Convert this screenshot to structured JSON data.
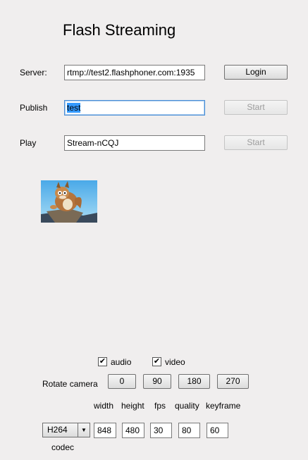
{
  "title": "Flash Streaming",
  "server": {
    "label": "Server:",
    "value": "rtmp://test2.flashphoner.com:1935",
    "button": "Login"
  },
  "publish": {
    "label": "Publish",
    "value": "test",
    "button": "Start"
  },
  "play": {
    "label": "Play",
    "value": "Stream-nCQJ",
    "button": "Start"
  },
  "media": {
    "audio_label": "audio",
    "video_label": "video",
    "audio_checked": true,
    "video_checked": true
  },
  "rotate": {
    "label": "Rotate camera",
    "options": [
      "0",
      "90",
      "180",
      "270"
    ]
  },
  "params": {
    "headers": [
      "width",
      "height",
      "fps",
      "quality",
      "keyframe"
    ],
    "values": [
      "848",
      "480",
      "30",
      "80",
      "60"
    ],
    "codec": "H264",
    "codec_label": "codec"
  }
}
